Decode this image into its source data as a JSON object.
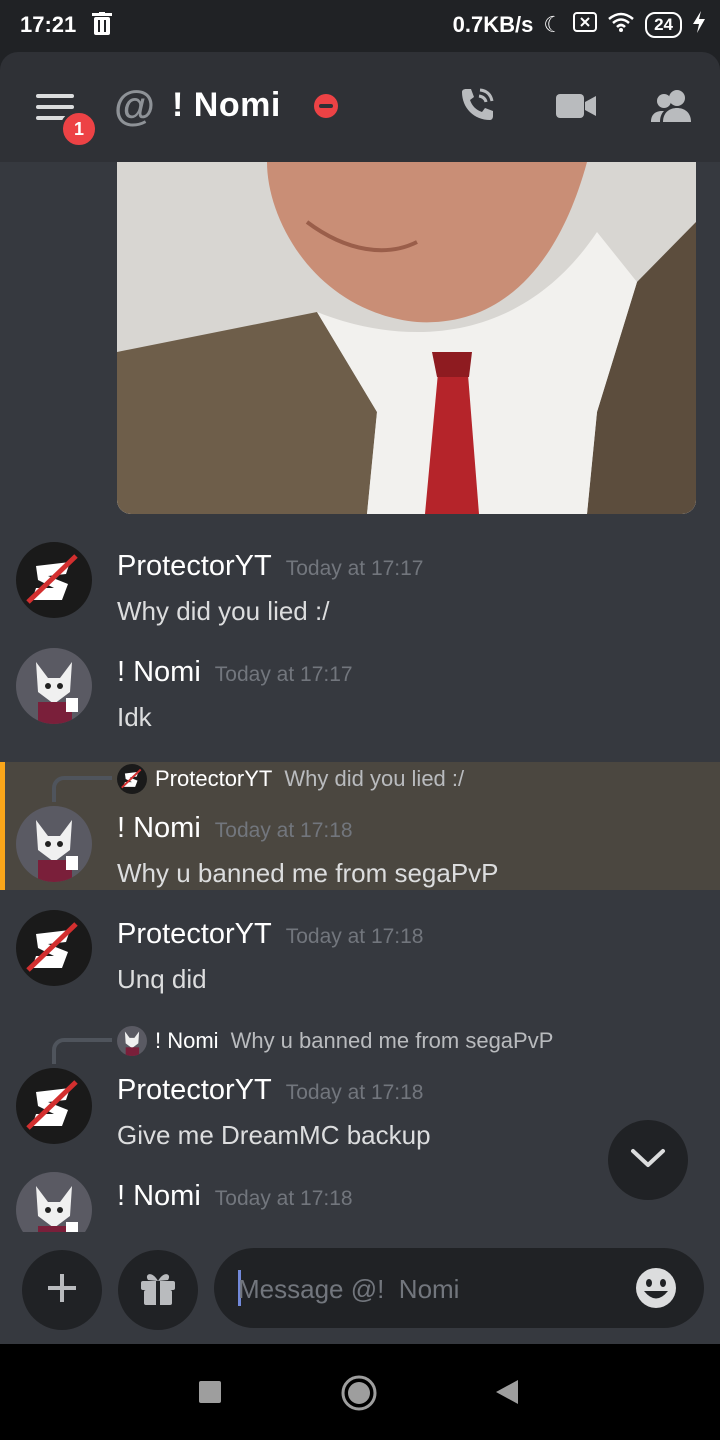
{
  "status_bar": {
    "time": "17:21",
    "net_speed": "0.7KB/s",
    "battery": "24"
  },
  "header": {
    "title": "!  Nomi",
    "notification_count": "1",
    "icons": [
      "menu-icon",
      "at-icon",
      "dnd-status-icon",
      "phone-call-icon",
      "video-call-icon",
      "members-icon"
    ]
  },
  "messages": [
    {
      "author": "ProtectorYT",
      "time": "Today at 17:17",
      "text": "Why did you lied :/"
    },
    {
      "author": "!  Nomi",
      "time": "Today at 17:17",
      "text": "Idk"
    },
    {
      "author": "!  Nomi",
      "time": "Today at 17:18",
      "text": "Why u banned me from segaPvP",
      "reply_to": {
        "author": "ProtectorYT",
        "text": "Why did you lied :/"
      }
    },
    {
      "author": "ProtectorYT",
      "time": "Today at 17:18",
      "text": "Unq did"
    },
    {
      "author": "ProtectorYT",
      "time": "Today at 17:18",
      "text": "Give me DreamMC backup",
      "reply_to": {
        "author": "!  Nomi",
        "text": "Why u banned me from segaPvP"
      }
    },
    {
      "author": "!  Nomi",
      "time": "Today at 17:18",
      "text": ""
    }
  ],
  "composer": {
    "placeholder": "Message @!  Nomi"
  },
  "colors": {
    "background": "#36393f",
    "header": "#2f3136",
    "accent_highlight": "#faa61a",
    "dnd_red": "#ed4245"
  }
}
